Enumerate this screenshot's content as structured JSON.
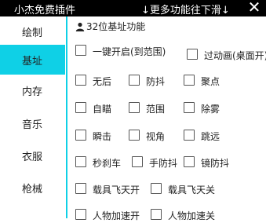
{
  "window": {
    "app_title": "小杰免费插件",
    "more_hint": "↓更多功能往下滑↓",
    "close_glyph": "✕"
  },
  "sidebar": {
    "items": [
      {
        "label": "绘制"
      },
      {
        "label": "基址"
      },
      {
        "label": "内存"
      },
      {
        "label": "音乐"
      },
      {
        "label": "衣服"
      },
      {
        "label": "枪械"
      }
    ],
    "active_index": 1,
    "accent_color": "#0fd0e6"
  },
  "section": {
    "icon": "user-icon",
    "title": "32位基址功能"
  },
  "options": [
    {
      "label": "一键开启(到范围)",
      "checked": false
    },
    {
      "label": "过动画(桌面开)",
      "checked": false
    },
    {
      "label": "无后",
      "checked": false
    },
    {
      "label": "防抖",
      "checked": false
    },
    {
      "label": "聚点",
      "checked": false
    },
    {
      "label": "自瞄",
      "checked": false
    },
    {
      "label": "范围",
      "checked": false
    },
    {
      "label": "除雾",
      "checked": false
    },
    {
      "label": "瞬击",
      "checked": false
    },
    {
      "label": "视角",
      "checked": false
    },
    {
      "label": "跳远",
      "checked": false
    },
    {
      "label": "秒刹车",
      "checked": false
    },
    {
      "label": "手防抖",
      "checked": false
    },
    {
      "label": "镜防抖",
      "checked": false
    },
    {
      "label": "载具飞天开",
      "checked": false
    },
    {
      "label": "载具飞天关",
      "checked": false
    },
    {
      "label": "人物加速开",
      "checked": false
    },
    {
      "label": "人物加速关",
      "checked": false
    }
  ]
}
